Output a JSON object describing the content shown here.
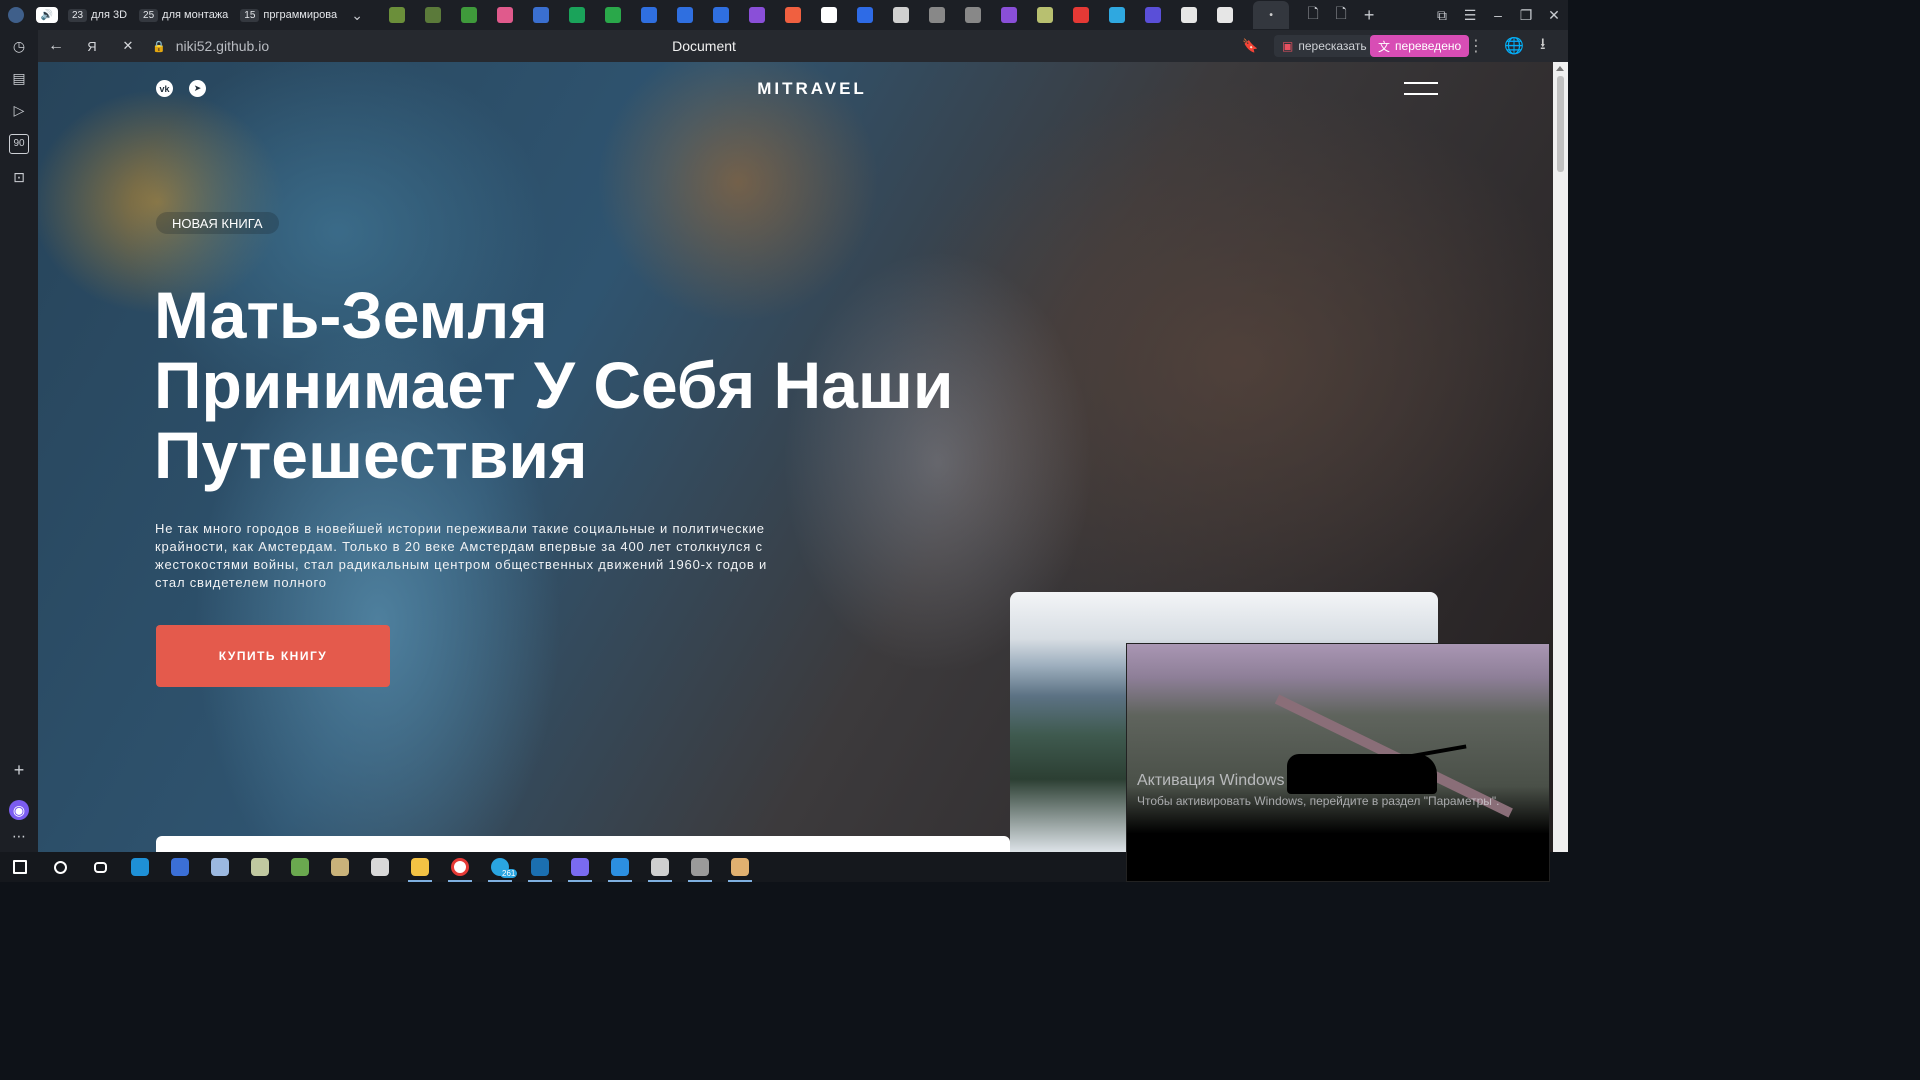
{
  "browser": {
    "tab_groups": [
      {
        "count": "23",
        "label": "для 3D"
      },
      {
        "count": "25",
        "label": "для монтажа"
      },
      {
        "count": "15",
        "label": "прграммирова"
      }
    ],
    "tab_icon_colors": [
      "#6b8f3a",
      "#5b7a3a",
      "#3f9a3b",
      "#e05a8c",
      "#3a6fd0",
      "#1aa35a",
      "#2aa84a",
      "#2f6fe0",
      "#2f6fe0",
      "#2f6fe0",
      "#8a4fd8",
      "#f06040",
      "#ffffff",
      "#2e6be6",
      "#d0d0d0",
      "#888888",
      "#888888",
      "#8a4fd8",
      "#b8c070",
      "#e53935",
      "#2fa8e0",
      "#5a4fd8",
      "#e6e6e6",
      "#e6e6e6"
    ],
    "url": "niki52.github.io",
    "page_title": "Document",
    "retell_label": "пересказать",
    "translated_label": "переведено"
  },
  "sidebar": {
    "icons": [
      "history-icon",
      "collections-icon",
      "video-icon",
      "counter-icon",
      "screenshot-icon",
      "add-icon",
      "alice-icon",
      "more-icon"
    ],
    "counter_label": "90"
  },
  "site": {
    "logo": "MITRAVEL",
    "social": [
      "vk-icon",
      "telegram-icon"
    ],
    "badge": "НОВАЯ КНИГА",
    "title_lines": [
      "Мать-Земля",
      "Принимает У Себя Наши",
      "Путешествия"
    ],
    "description": "Не так много городов в новейшей истории переживали такие социальные и политические крайности, как Амстердам. Только в 20 веке Амстердам впервые за 400 лет столкнулся с жестокостями войны, стал радикальным центром общественных движений 1960-х годов и стал свидетелем полного",
    "cta": "КУПИТЬ КНИГУ",
    "accent": "#e45a4c"
  },
  "overlay": {
    "activation_title": "Активация Windows",
    "activation_text": "Чтобы активировать Windows, перейдите в раздел \"Параметры\"."
  },
  "taskbar": {
    "icons": [
      {
        "name": "start-icon",
        "color": "#ffffff"
      },
      {
        "name": "search-icon",
        "color": "#ffffff"
      },
      {
        "name": "task-view-icon",
        "color": "#ffffff"
      },
      {
        "name": "edge-icon",
        "color": "#1e90d6"
      },
      {
        "name": "app-icon",
        "color": "#3b6fd6"
      },
      {
        "name": "notepad-icon",
        "color": "#9bb8e0"
      },
      {
        "name": "game-icon",
        "color": "#c0c8a0"
      },
      {
        "name": "tank-game-icon",
        "color": "#6aa84f"
      },
      {
        "name": "game-icon-2",
        "color": "#c9b27a"
      },
      {
        "name": "settings-icon",
        "color": "#d8d8d8"
      },
      {
        "name": "explorer-icon",
        "color": "#f3c244"
      },
      {
        "name": "yandex-browser-icon",
        "color": "#ffffff"
      },
      {
        "name": "telegram-icon",
        "color": "#2aa5e0"
      },
      {
        "name": "steam-icon",
        "color": "#1b6fb0"
      },
      {
        "name": "discord-icon",
        "color": "#7a6bf0"
      },
      {
        "name": "vscode-icon",
        "color": "#2c8fe0"
      },
      {
        "name": "app-a-icon",
        "color": "#cfcfcf"
      },
      {
        "name": "world-of-tanks-icon",
        "color": "#9a9a9a"
      },
      {
        "name": "game-cross-icon",
        "color": "#e0b070"
      }
    ],
    "active": [
      "explorer-icon",
      "yandex-browser-icon",
      "telegram-icon",
      "steam-icon",
      "discord-icon",
      "vscode-icon",
      "app-a-icon",
      "world-of-tanks-icon",
      "game-cross-icon"
    ],
    "telegram_badge": "261"
  }
}
